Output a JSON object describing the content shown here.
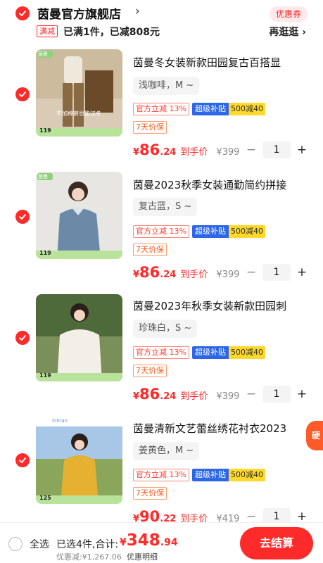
{
  "store": {
    "name": "茵曼官方旗舰店",
    "arrow": "›",
    "coupon_label": "优惠券"
  },
  "promo": {
    "tag": "满减",
    "text": "已满1件，已减808元",
    "more": "再逛逛 ›"
  },
  "items": [
    {
      "title": "茵曼冬女装新款田园复古百搭显",
      "sku": "浅咖啡，M ~",
      "tag_official": "官方立减 13%",
      "tag_subsidy": "超级补贴",
      "tag_coupon": "500减40",
      "tag_return": "7天价保",
      "price_symbol": "¥",
      "price_int": "86",
      "price_dec": ".24",
      "price_label": "到手价",
      "price_orig": "¥399",
      "qty": "1",
      "thumb_caption": "不加棉裤也能过冬",
      "thumb_price": "119",
      "thumb_badge": "茵曼"
    },
    {
      "title": "茵曼2023秋季女装通勤简约拼接",
      "sku": "复古蓝，S ~",
      "tag_official": "官方立减 13%",
      "tag_subsidy": "超级补贴",
      "tag_coupon": "500减40",
      "tag_return": "7天价保",
      "price_symbol": "¥",
      "price_int": "86",
      "price_dec": ".24",
      "price_label": "到手价",
      "price_orig": "¥399",
      "qty": "1",
      "thumb_caption": "",
      "thumb_price": "119",
      "thumb_badge": "茵曼"
    },
    {
      "title": "茵曼2023年秋季女装新款田园刺",
      "sku": "珍珠白，S ~",
      "tag_official": "官方立减 13%",
      "tag_subsidy": "超级补贴",
      "tag_coupon": "500减40",
      "tag_return": "7天价保",
      "price_symbol": "¥",
      "price_int": "86",
      "price_dec": ".24",
      "price_label": "到手价",
      "price_orig": "¥399",
      "qty": "1",
      "thumb_caption": "",
      "thumb_price": "119",
      "thumb_badge": ""
    },
    {
      "title": "茵曼清新文艺蕾丝绣花衬衣2023",
      "sku": "姜黄色，M ~",
      "tag_official": "官方立减 13%",
      "tag_subsidy": "超级补贴",
      "tag_coupon": "500减40",
      "tag_return": "7天价保",
      "price_symbol": "¥",
      "price_int": "90",
      "price_dec": ".22",
      "price_label": "到手价",
      "price_orig": "¥419",
      "qty": "1",
      "thumb_caption": "",
      "thumb_price": "125",
      "thumb_badge": "inman"
    }
  ],
  "float_badge": "硬",
  "bottom": {
    "select_all": "全选",
    "selected": "已选4件,合计:",
    "total_symbol": "¥",
    "total_int": "348",
    "total_dec": ".94",
    "discount": "优惠减:¥1,267.06",
    "discount_link": "优惠明细",
    "checkout": "去结算"
  },
  "colors": {
    "accent": "#ff2a2a",
    "subsidy_blue": "#2b66e8",
    "coupon_yellow": "#ffd92a"
  }
}
